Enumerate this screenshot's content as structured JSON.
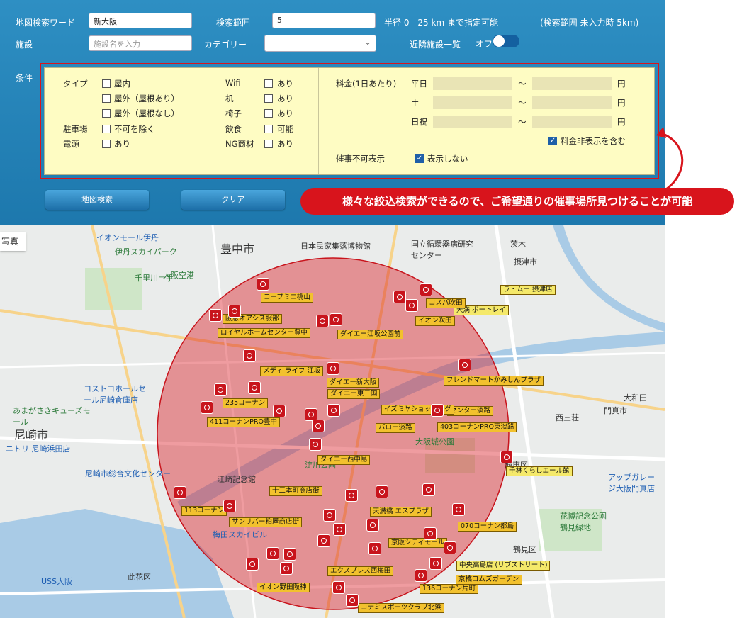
{
  "search": {
    "keyword_label": "地図検索ワード",
    "keyword_value": "新大阪",
    "range_label": "検索範囲",
    "range_value": "5",
    "range_hint": "半径 0 - 25 km まで指定可能",
    "range_default_hint": "(検索範囲 未入力時 5km)",
    "facility_label": "施設",
    "facility_placeholder": "施設名を入力",
    "category_label": "カテゴリー",
    "category_value": "",
    "nearby_label": "近隣施設一覧",
    "nearby_toggle_text": "オフ"
  },
  "conditions": {
    "label": "条件",
    "type_label": "タイプ",
    "type_options": [
      "屋内",
      "屋外（屋根あり）",
      "屋外（屋根なし）"
    ],
    "parking_label": "駐車場",
    "parking_option": "不可を除く",
    "power_label": "電源",
    "power_option": "あり",
    "amenities": [
      {
        "label": "Wifi",
        "option": "あり"
      },
      {
        "label": "机",
        "option": "あり"
      },
      {
        "label": "椅子",
        "option": "あり"
      },
      {
        "label": "飲食",
        "option": "可能"
      },
      {
        "label": "NG商材",
        "option": "あり"
      }
    ],
    "fee_label": "料金(1日あたり)",
    "fee_rows": [
      {
        "day": "平日",
        "tilde": "～",
        "unit": "円"
      },
      {
        "day": "土",
        "tilde": "～",
        "unit": "円"
      },
      {
        "day": "日祝",
        "tilde": "～",
        "unit": "円"
      }
    ],
    "fee_hidden_label": "料金非表示を含む",
    "event_unavailable_label": "催事不可表示",
    "event_unavailable_option": "表示しない"
  },
  "buttons": {
    "map_search": "地図検索",
    "clear": "クリア"
  },
  "callout": "様々な絞込検索ができるので、ご希望通りの催事場所見つけることが可能",
  "map": {
    "photo_tab": "写真",
    "place_labels": [
      "豊中市",
      "尼崎市",
      "イオンモール伊丹",
      "伊丹スカイパーク",
      "千里川土手",
      "国立循環器病研究センター",
      "日本民家集落博物館",
      "摂津市",
      "西三荘",
      "門真市",
      "大阪城公園",
      "淀川公園",
      "江崎記念館",
      "梅田スカイビル",
      "USS大阪",
      "花博記念公園鶴見緑地",
      "鶴見区",
      "尼崎市総合文化センター",
      "あまがさきキューズモール",
      "コストコホールセール尼崎倉庫店",
      "ニトリ 尼崎浜田店",
      "アップガレージ大阪門真店",
      "此花区",
      "城東区",
      "大和田",
      "茨木",
      "大阪空港"
    ],
    "facility_tags": [
      "コープミニ桃山",
      "阪急オアシス服部",
      "ロイヤルホームセンター豊中",
      "ダイエー江坂公園前",
      "イオン吹田",
      "ダイエー東三国",
      "フレンドマートかみしんプラザ",
      "235コーナン",
      "411コーナンPRO豊中",
      "403コーナンPRO東淡路",
      "パロー淡路",
      "ダイエー西中島",
      "十三本町商店街",
      "113コーナン",
      "サンリバー粕屋商店街",
      "070コーナン都島",
      "136コーナン片町",
      "千林くらしエール館",
      "イオン野田阪神",
      "コナミスポーツクラブ北浜",
      "京橋コムズガーデン",
      "京阪シティモール",
      "エクスプレス西梅田",
      "ラ・ムー 摂津店",
      "天満 ポートレイ",
      "中央高島店 (リブストリート)",
      "メディ ライフ 江坂",
      "コスパ吹田",
      "センター淡路",
      "イズミヤショッピング",
      "ダイエー新大阪",
      "天満橋 エスプラザ"
    ]
  },
  "colors": {
    "panel": "#1d78ad",
    "condition_bg": "#fefcc3",
    "accent_red": "#d8141c",
    "circle": "#d8141c",
    "tag": "#f2c12e"
  }
}
